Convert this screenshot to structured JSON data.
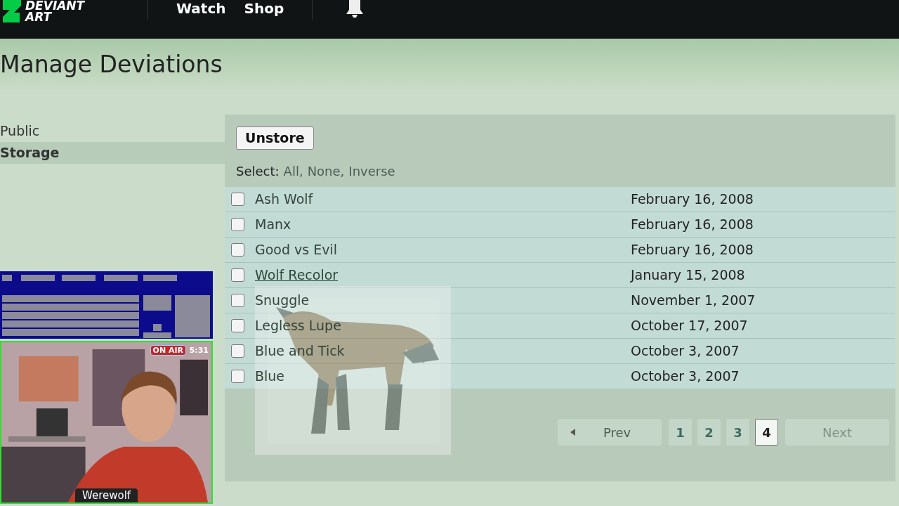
{
  "topbar": {
    "logo": [
      "DEVIANT",
      "ART"
    ],
    "nav": [
      "Watch",
      "Shop"
    ]
  },
  "page_title": "Manage Deviations",
  "sidebar": [
    {
      "label": "Public",
      "selected": false
    },
    {
      "label": "Storage",
      "selected": true
    }
  ],
  "toolbar": {
    "button": "Unstore",
    "select_label": "Select:",
    "select_links": [
      "All,",
      "None,",
      "Inverse"
    ]
  },
  "rows": [
    {
      "title": "Ash Wolf",
      "date": "February 16, 2008",
      "checked": false,
      "hovered": false
    },
    {
      "title": "Manx",
      "date": "February 16, 2008",
      "checked": false,
      "hovered": false
    },
    {
      "title": "Good vs Evil",
      "date": "February 16, 2008",
      "checked": false,
      "hovered": false
    },
    {
      "title": "Wolf Recolor",
      "date": "January 15, 2008",
      "checked": false,
      "hovered": true
    },
    {
      "title": "Snuggle",
      "date": "November 1, 2007",
      "checked": false,
      "hovered": false
    },
    {
      "title": "Legless Lupe",
      "date": "October 17, 2007",
      "checked": false,
      "hovered": false
    },
    {
      "title": "Blue and Tick",
      "date": "October 3, 2007",
      "checked": false,
      "hovered": false
    },
    {
      "title": "Blue",
      "date": "October 3, 2007",
      "checked": false,
      "hovered": false
    }
  ],
  "pagination": {
    "prev": "Prev",
    "pages": [
      {
        "label": "1",
        "selected": false
      },
      {
        "label": "2",
        "selected": false
      },
      {
        "label": "3",
        "selected": false
      },
      {
        "label": "4",
        "selected": true
      }
    ],
    "next": "Next",
    "next_disabled": true
  },
  "webcam": {
    "badge": "ON AIR",
    "time": "5:31",
    "name": "Werewolf"
  }
}
